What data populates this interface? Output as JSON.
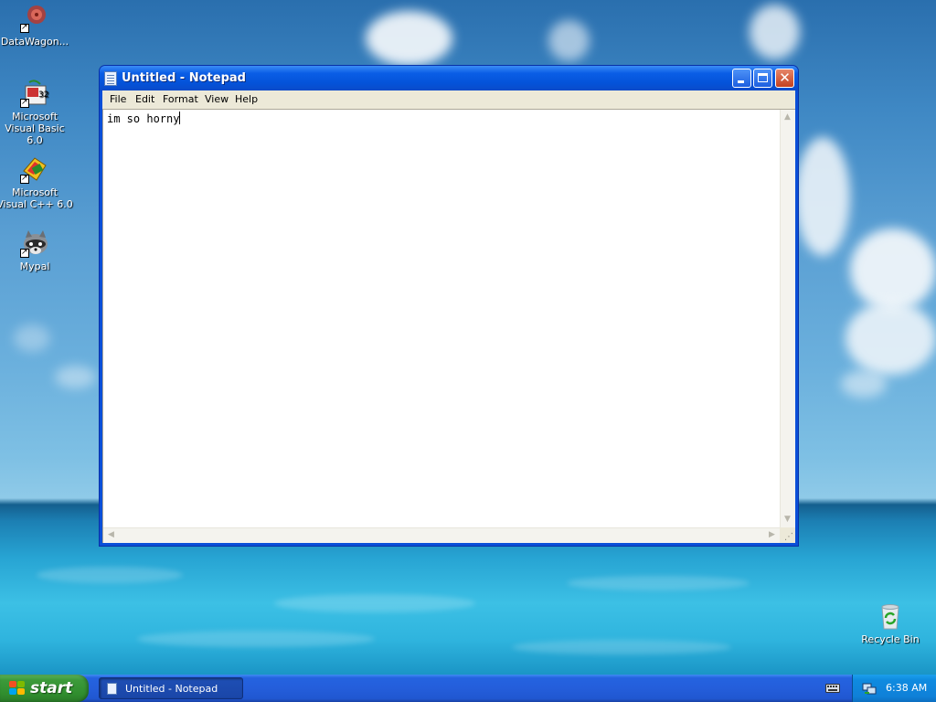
{
  "desktop": {
    "icons": [
      {
        "label": "DataWagon...",
        "icon": "datawagon-icon"
      },
      {
        "label": "Microsoft Visual Basic 6.0",
        "icon": "visual-basic-icon"
      },
      {
        "label": "Microsoft Visual C++ 6.0",
        "icon": "visual-cpp-icon"
      },
      {
        "label": "Mypal",
        "icon": "raccoon-icon"
      },
      {
        "label": "Recycle Bin",
        "icon": "recycle-bin-icon"
      }
    ]
  },
  "window": {
    "title": "Untitled - Notepad",
    "menu": [
      "File",
      "Edit",
      "Format",
      "View",
      "Help"
    ],
    "content": "im so horny"
  },
  "taskbar": {
    "start_label": "start",
    "tasks": [
      {
        "label": "Untitled - Notepad"
      }
    ],
    "clock": "6:38 AM"
  },
  "colors": {
    "titlebar": "#0453d9",
    "taskbar": "#245edb",
    "start_button": "#3c9a3a",
    "tray": "#0f8be0"
  }
}
